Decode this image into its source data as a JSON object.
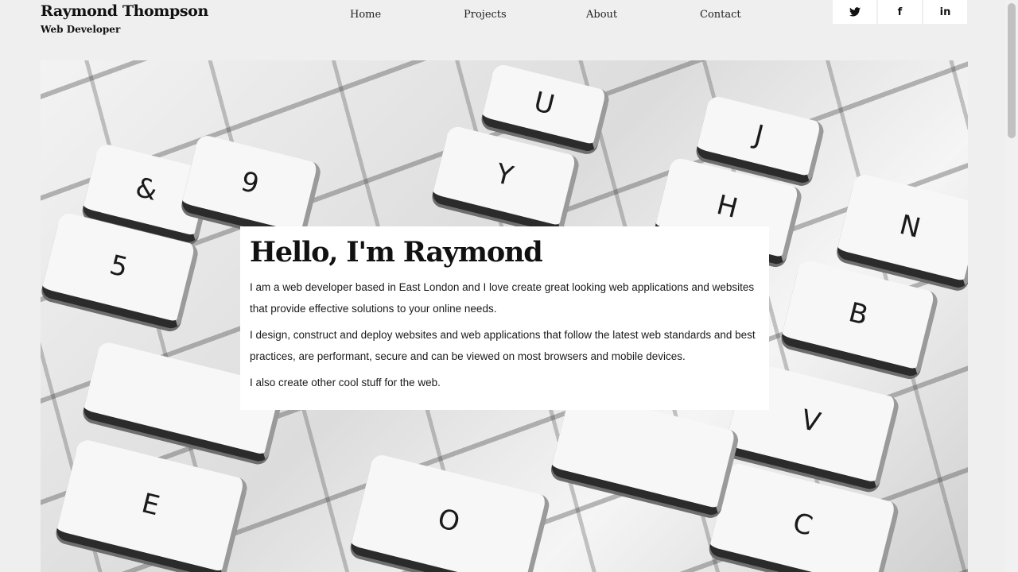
{
  "header": {
    "name": "Raymond Thompson",
    "role": "Web Developer",
    "nav": [
      "Home",
      "Projects",
      "About",
      "Contact"
    ],
    "social": [
      {
        "icon": "twitter-icon",
        "glyph": "🐦︎"
      },
      {
        "icon": "facebook-icon",
        "glyph": "f"
      },
      {
        "icon": "linkedin-icon",
        "glyph": "in"
      }
    ]
  },
  "hero": {
    "keys": [
      "&",
      "9",
      "U",
      "Y",
      "H",
      "J",
      "N",
      "B",
      "5",
      "V",
      "C",
      "E",
      "O"
    ]
  },
  "intro": {
    "title": "Hello, I'm Raymond",
    "paragraphs": [
      "I am a web developer based in East London and I love create great looking web applications and websites that provide effective solutions to your online needs.",
      "I design, construct and deploy websites and web applications that follow the latest web standards and best practices, are performant, secure and can be viewed on most browsers and mobile devices.",
      "I also create other cool stuff for the web."
    ]
  }
}
